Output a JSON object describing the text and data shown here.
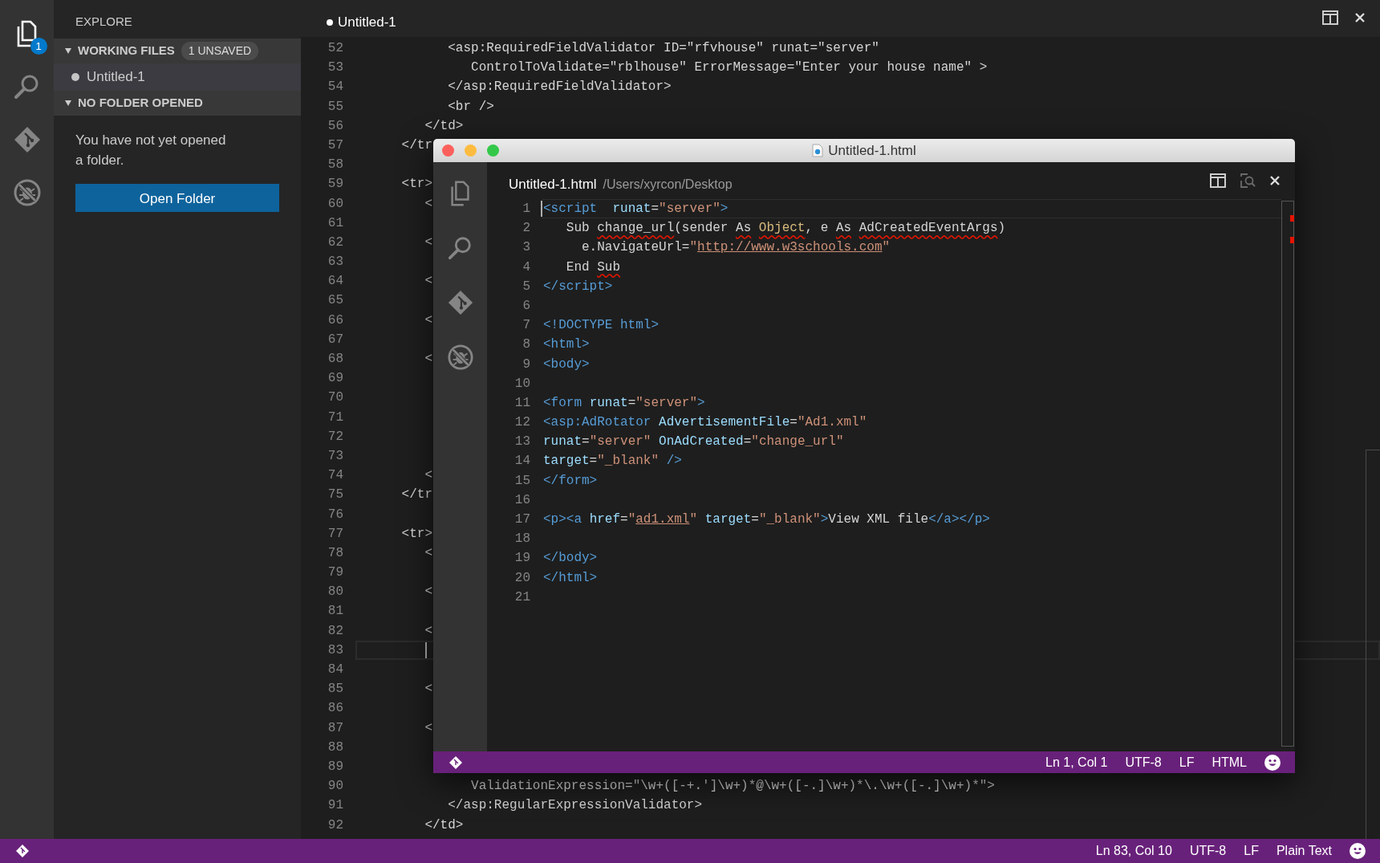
{
  "activity_bar": {
    "items": [
      {
        "kind": "files",
        "selected": true,
        "badge": "1"
      },
      {
        "kind": "search",
        "selected": false
      },
      {
        "kind": "branch",
        "selected": false
      },
      {
        "kind": "debug",
        "selected": false
      }
    ]
  },
  "sidebar": {
    "title": "EXPLORE",
    "sections": [
      {
        "title": "WORKING FILES",
        "badge": "1 UNSAVED",
        "expanded": true,
        "files": [
          {
            "name": "Untitled-1",
            "dirty": true,
            "selected": true
          }
        ]
      },
      {
        "title": "NO FOLDER OPENED",
        "expanded": true,
        "message": "You have not yet opened a folder.",
        "button": "Open Folder"
      }
    ]
  },
  "editor": {
    "tab": {
      "label": "Untitled-1",
      "dirty": true
    },
    "lines": [
      {
        "number": "52",
        "text": "            <asp:RequiredFieldValidator ID=\"rfvhouse\" runat=\"server\"",
        "current": false
      },
      {
        "number": "53",
        "text": "               ControlToValidate=\"rblhouse\" ErrorMessage=\"Enter your house name\" >",
        "current": false
      },
      {
        "number": "54",
        "text": "            </asp:RequiredFieldValidator>",
        "current": false
      },
      {
        "number": "55",
        "text": "            <br />",
        "current": false
      },
      {
        "number": "56",
        "text": "         </td>",
        "current": false
      },
      {
        "number": "57",
        "text": "      </tr",
        "current": false
      },
      {
        "number": "58",
        "current": false
      },
      {
        "number": "59",
        "text": "      <tr>",
        "current": false
      },
      {
        "number": "60",
        "text": "         <",
        "current": false
      },
      {
        "number": "61",
        "current": false
      },
      {
        "number": "62",
        "text": "         <",
        "current": false
      },
      {
        "number": "63",
        "current": false
      },
      {
        "number": "64",
        "text": "         <",
        "current": false
      },
      {
        "number": "65",
        "current": false
      },
      {
        "number": "66",
        "text": "         <",
        "current": false
      },
      {
        "number": "67",
        "current": false
      },
      {
        "number": "68",
        "text": "         <",
        "current": false
      },
      {
        "number": "69",
        "current": false
      },
      {
        "number": "70",
        "current": false
      },
      {
        "number": "71",
        "current": false
      },
      {
        "number": "72",
        "current": false
      },
      {
        "number": "73",
        "current": false
      },
      {
        "number": "74",
        "text": "         <",
        "current": false
      },
      {
        "number": "75",
        "text": "      </tr",
        "current": false
      },
      {
        "number": "76",
        "current": false
      },
      {
        "number": "77",
        "text": "      <tr>",
        "current": false
      },
      {
        "number": "78",
        "text": "         <",
        "current": false
      },
      {
        "number": "79",
        "current": false
      },
      {
        "number": "80",
        "text": "         <",
        "current": false
      },
      {
        "number": "81",
        "current": false
      },
      {
        "number": "82",
        "text": "         <",
        "current": false
      },
      {
        "number": "83",
        "current": true
      },
      {
        "number": "84",
        "current": false
      },
      {
        "number": "85",
        "text": "         <",
        "current": false
      },
      {
        "number": "86",
        "current": false
      },
      {
        "number": "87",
        "text": "         <",
        "current": false
      },
      {
        "number": "88",
        "current": false
      },
      {
        "number": "89",
        "current": false
      },
      {
        "number": "90",
        "text": "               ValidationExpression=\"\\w+([-+.']\\w+)*@\\w+([-.]\\w+)*\\.\\w+([-.]\\w+)*\">",
        "current": false
      },
      {
        "number": "91",
        "text": "            </asp:RegularExpressionValidator>",
        "current": false
      },
      {
        "number": "92",
        "text": "         </td>",
        "current": false
      }
    ]
  },
  "status_bar": {
    "items": [
      "Ln 83, Col 10",
      "UTF-8",
      "LF",
      "Plain Text"
    ]
  },
  "window": {
    "title": "Untitled-1.html",
    "file": "Untitled-1.html",
    "path": "/Users/xyrcon/Desktop",
    "activity_bar": [
      {
        "kind": "files",
        "selected": false
      },
      {
        "kind": "search",
        "selected": false
      },
      {
        "kind": "branch",
        "selected": false
      },
      {
        "kind": "debug",
        "selected": false
      }
    ],
    "lines": [
      {
        "number": "1",
        "current": true,
        "tokens": [
          {
            "text": "<script",
            "kind": "tag",
            "error": false
          },
          {
            "text": "  runat",
            "kind": "attr",
            "error": false
          },
          {
            "text": "=",
            "kind": "text",
            "error": false
          },
          {
            "text": "\"server\"",
            "kind": "string",
            "error": false
          },
          {
            "text": ">",
            "kind": "tag",
            "error": false
          }
        ]
      },
      {
        "number": "2",
        "current": false,
        "tokens": [
          {
            "text": "   Sub ",
            "kind": "text",
            "error": false
          },
          {
            "text": "change_url",
            "kind": "text",
            "error": true
          },
          {
            "text": "(sender ",
            "kind": "text",
            "error": false
          },
          {
            "text": "As",
            "kind": "text",
            "error": true
          },
          {
            "text": " Object",
            "kind": "type",
            "error": true
          },
          {
            "text": ", e ",
            "kind": "text",
            "error": false
          },
          {
            "text": "As",
            "kind": "text",
            "error": true
          },
          {
            "text": " AdCreatedEventArgs",
            "kind": "text",
            "error": true
          },
          {
            "text": ")",
            "kind": "text",
            "error": false
          }
        ]
      },
      {
        "number": "3",
        "current": false,
        "tokens": [
          {
            "text": "     e.NavigateUrl=",
            "kind": "text",
            "error": false
          },
          {
            "text": "\"",
            "kind": "string",
            "error": false
          },
          {
            "text": "http://www.w3schools.com",
            "kind": "link",
            "error": false
          },
          {
            "text": "\"",
            "kind": "string",
            "error": false
          }
        ]
      },
      {
        "number": "4",
        "current": false,
        "tokens": [
          {
            "text": "   End ",
            "kind": "text",
            "error": false
          },
          {
            "text": "Sub",
            "kind": "text",
            "error": true
          }
        ]
      },
      {
        "number": "5",
        "current": false,
        "tokens": [
          {
            "text": "</script>",
            "kind": "tag",
            "error": false
          }
        ]
      },
      {
        "number": "6",
        "current": false
      },
      {
        "number": "7",
        "current": false,
        "tokens": [
          {
            "text": "<!DOCTYPE html>",
            "kind": "tag",
            "error": false
          }
        ]
      },
      {
        "number": "8",
        "current": false,
        "tokens": [
          {
            "text": "<html>",
            "kind": "tag",
            "error": false
          }
        ]
      },
      {
        "number": "9",
        "current": false,
        "tokens": [
          {
            "text": "<body>",
            "kind": "tag",
            "error": false
          }
        ]
      },
      {
        "number": "10",
        "current": false
      },
      {
        "number": "11",
        "current": false,
        "tokens": [
          {
            "text": "<form",
            "kind": "tag",
            "error": false
          },
          {
            "text": " runat",
            "kind": "attr",
            "error": false
          },
          {
            "text": "=",
            "kind": "text",
            "error": false
          },
          {
            "text": "\"server\"",
            "kind": "string",
            "error": false
          },
          {
            "text": ">",
            "kind": "tag",
            "error": false
          }
        ]
      },
      {
        "number": "12",
        "current": false,
        "tokens": [
          {
            "text": "<asp:AdRotator",
            "kind": "tag",
            "error": false
          },
          {
            "text": " AdvertisementFile",
            "kind": "attr",
            "error": false
          },
          {
            "text": "=",
            "kind": "text",
            "error": false
          },
          {
            "text": "\"Ad1.xml\"",
            "kind": "string",
            "error": false
          }
        ]
      },
      {
        "number": "13",
        "current": false,
        "tokens": [
          {
            "text": "runat",
            "kind": "attr",
            "error": false
          },
          {
            "text": "=",
            "kind": "text",
            "error": false
          },
          {
            "text": "\"server\"",
            "kind": "string",
            "error": false
          },
          {
            "text": " OnAdCreated",
            "kind": "attr",
            "error": false
          },
          {
            "text": "=",
            "kind": "text",
            "error": false
          },
          {
            "text": "\"change_url\"",
            "kind": "string",
            "error": false
          }
        ]
      },
      {
        "number": "14",
        "current": false,
        "tokens": [
          {
            "text": "target",
            "kind": "attr",
            "error": false
          },
          {
            "text": "=",
            "kind": "text",
            "error": false
          },
          {
            "text": "\"_blank\"",
            "kind": "string",
            "error": false
          },
          {
            "text": " />",
            "kind": "tag",
            "error": false
          }
        ]
      },
      {
        "number": "15",
        "current": false,
        "tokens": [
          {
            "text": "</form>",
            "kind": "tag",
            "error": false
          }
        ]
      },
      {
        "number": "16",
        "current": false
      },
      {
        "number": "17",
        "current": false,
        "tokens": [
          {
            "text": "<p><a",
            "kind": "tag",
            "error": false
          },
          {
            "text": " href",
            "kind": "attr",
            "error": false
          },
          {
            "text": "=",
            "kind": "text",
            "error": false
          },
          {
            "text": "\"",
            "kind": "string",
            "error": false
          },
          {
            "text": "ad1.xml",
            "kind": "link",
            "error": false
          },
          {
            "text": "\"",
            "kind": "string",
            "error": false
          },
          {
            "text": " target",
            "kind": "attr",
            "error": false
          },
          {
            "text": "=",
            "kind": "text",
            "error": false
          },
          {
            "text": "\"_blank\"",
            "kind": "string",
            "error": false
          },
          {
            "text": ">",
            "kind": "tag",
            "error": false
          },
          {
            "text": "View XML file",
            "kind": "text",
            "error": false
          },
          {
            "text": "</a></p>",
            "kind": "tag",
            "error": false
          }
        ]
      },
      {
        "number": "18",
        "current": false
      },
      {
        "number": "19",
        "current": false,
        "tokens": [
          {
            "text": "</body>",
            "kind": "tag",
            "error": false
          }
        ]
      },
      {
        "number": "20",
        "current": false,
        "tokens": [
          {
            "text": "</html>",
            "kind": "tag",
            "error": false
          }
        ]
      },
      {
        "number": "21",
        "current": false
      }
    ],
    "status_bar": {
      "items": [
        "Ln 1, Col 1",
        "UTF-8",
        "LF",
        "HTML"
      ]
    }
  }
}
